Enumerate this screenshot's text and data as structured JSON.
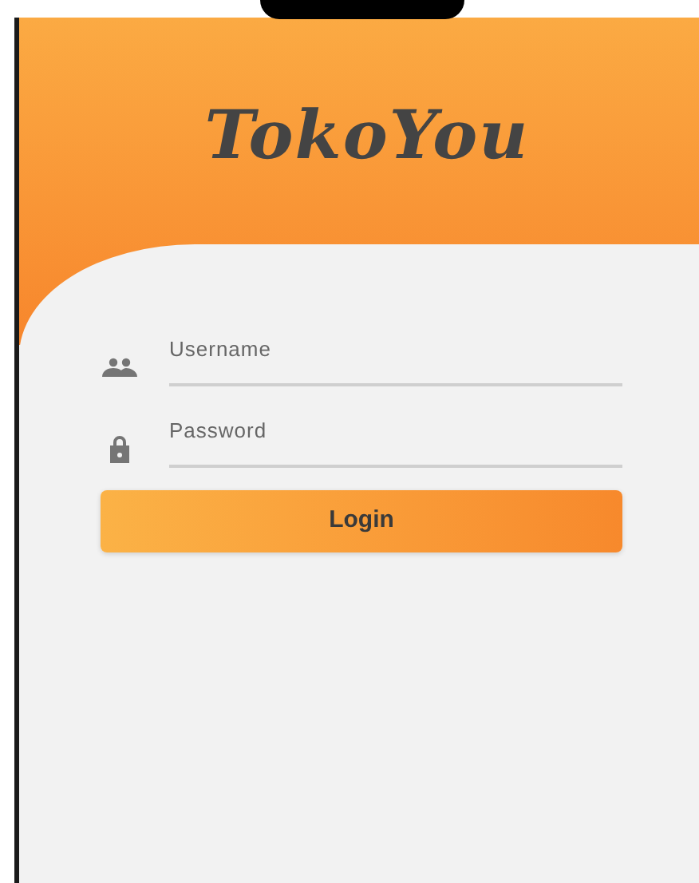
{
  "app_title": "TokoYou",
  "fields": [
    {
      "kind": "user",
      "placeholder": "Username"
    },
    {
      "kind": "lock",
      "placeholder": "Password"
    }
  ],
  "login_button": {
    "label": "Login"
  }
}
